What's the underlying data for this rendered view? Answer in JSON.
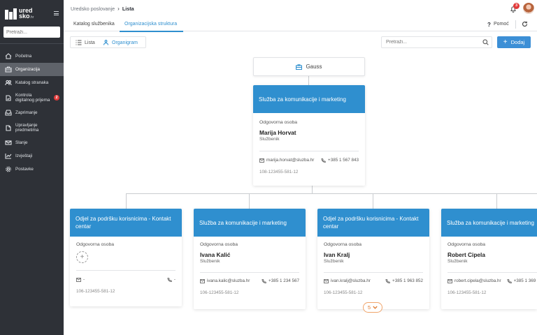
{
  "app": {
    "logo_text_line1": "ured",
    "logo_text_line2": "sko",
    "logo_suffix": ".hr"
  },
  "sidebar": {
    "search_placeholder": "Pretraži...",
    "items": [
      {
        "label": "Početna",
        "icon": "home-icon"
      },
      {
        "label": "Organizacija",
        "icon": "briefcase-icon",
        "active": true
      },
      {
        "label": "Katalog stranaka",
        "icon": "users-icon"
      },
      {
        "label": "Kontrola digitalnog prijema",
        "icon": "document-check-icon",
        "badge": "2"
      },
      {
        "label": "Zaprimanje",
        "icon": "inbox-icon"
      },
      {
        "label": "Upravljanje predmetima",
        "icon": "file-icon"
      },
      {
        "label": "Slanje",
        "icon": "send-icon"
      },
      {
        "label": "Izvještaji",
        "icon": "chart-icon"
      },
      {
        "label": "Postavke",
        "icon": "gear-icon"
      }
    ]
  },
  "header": {
    "breadcrumb_parent": "Uredsko poslovanje",
    "breadcrumb_current": "Lista",
    "notifications_count": "3"
  },
  "tabs": {
    "items": [
      {
        "label": "Katalog službenika"
      },
      {
        "label": "Organizacijska struktura",
        "active": true
      }
    ],
    "help_label": "Pomoć"
  },
  "toolbar": {
    "view_list_label": "Lista",
    "view_org_label": "Organigram",
    "search_placeholder": "Pretraži...",
    "add_label": "Dodaj"
  },
  "orgchart": {
    "root_label": "Gauss",
    "main": {
      "title": "Služba za komunikacije i marketing",
      "role_label": "Odgovorna osoba",
      "name": "Marija Horvat",
      "position": "Službenik",
      "email": "marija.horvat@sluzba.hr",
      "phone": "+385 1 567 843",
      "code": "108-123455-581-12"
    },
    "children": [
      {
        "title": "Odjel za podršku korisnicima - Kontakt centar",
        "role_label": "Odgovorna osoba",
        "name": "",
        "position": "",
        "email": "-",
        "phone": "-",
        "code": "106-123455-581-12",
        "empty": true
      },
      {
        "title": "Služba za komunikacije i marketing",
        "role_label": "Odgovorna osoba",
        "name": "Ivana Kalić",
        "position": "Službenik",
        "email": "ivana.kalic@sluzba.hr",
        "phone": "+385 1 234 567",
        "code": "106-123455-581-12"
      },
      {
        "title": "Odjel za podršku korisnicima - Kontakt centar",
        "role_label": "Odgovorna osoba",
        "name": "Ivan Kralj",
        "position": "Službenik",
        "email": "ivan.kralj@sluzba.hr",
        "phone": "+385 1 963 852",
        "code": "106-123455-581-12"
      },
      {
        "title": "Služba za komunikacije i marketing",
        "role_label": "Odgovorna osoba",
        "name": "Robert Cipela",
        "position": "Službenik",
        "email": "robert.cipela@sluzba.hr",
        "phone": "+385 1 369",
        "code": "106-123455-581-12"
      }
    ],
    "more_count": "5"
  },
  "colors": {
    "accent": "#2f8fcf",
    "sidebar_bg": "#2e3137",
    "badge": "#e23a3a",
    "more": "#e07b30"
  }
}
